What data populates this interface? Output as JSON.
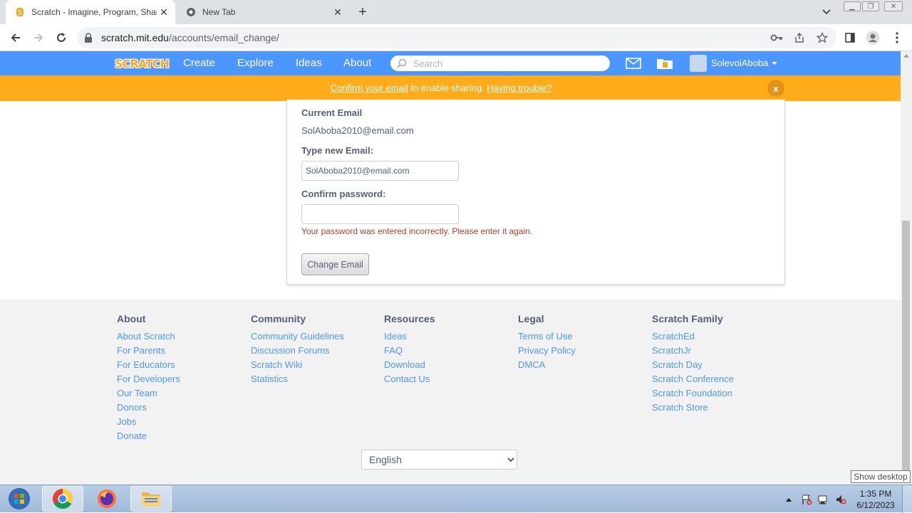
{
  "browser": {
    "tabs": [
      {
        "title": "Scratch - Imagine, Program, Share",
        "active": true
      },
      {
        "title": "New Tab",
        "active": false
      }
    ],
    "url_host": "scratch.mit.edu",
    "url_path": "/accounts/email_change/"
  },
  "scratch_header": {
    "logo_text": "SCRATCH",
    "nav": [
      "Create",
      "Explore",
      "Ideas",
      "About"
    ],
    "search_placeholder": "Search",
    "username": "SolevoiAboba",
    "brand_color": "#4c97ff"
  },
  "banner": {
    "link1": "Confirm your email",
    "text": " to enable sharing. ",
    "link2": "Having trouble?",
    "close_label": "x",
    "color": "#ffab1a"
  },
  "form": {
    "current_email_label": "Current Email",
    "current_email_value": "SolAboba2010@email.com",
    "new_email_label": "Type new Email:",
    "new_email_value": "SolAboba2010@email.com",
    "password_label": "Confirm password:",
    "password_value": "",
    "error_text": "Your password was entered incorrectly. Please enter it again.",
    "submit_label": "Change Email"
  },
  "footer": {
    "columns": [
      {
        "heading": "About",
        "links": [
          "About Scratch",
          "For Parents",
          "For Educators",
          "For Developers",
          "Our Team",
          "Donors",
          "Jobs",
          "Donate"
        ]
      },
      {
        "heading": "Community",
        "links": [
          "Community Guidelines",
          "Discussion Forums",
          "Scratch Wiki",
          "Statistics"
        ]
      },
      {
        "heading": "Resources",
        "links": [
          "Ideas",
          "FAQ",
          "Download",
          "Contact Us"
        ]
      },
      {
        "heading": "Legal",
        "links": [
          "Terms of Use",
          "Privacy Policy",
          "DMCA"
        ]
      },
      {
        "heading": "Scratch Family",
        "links": [
          "ScratchEd",
          "ScratchJr",
          "Scratch Day",
          "Scratch Conference",
          "Scratch Foundation",
          "Scratch Store"
        ]
      }
    ],
    "language_selected": "English"
  },
  "taskbar": {
    "time": "1:35 PM",
    "date": "6/12/2023",
    "tooltip": "Show desktop"
  }
}
